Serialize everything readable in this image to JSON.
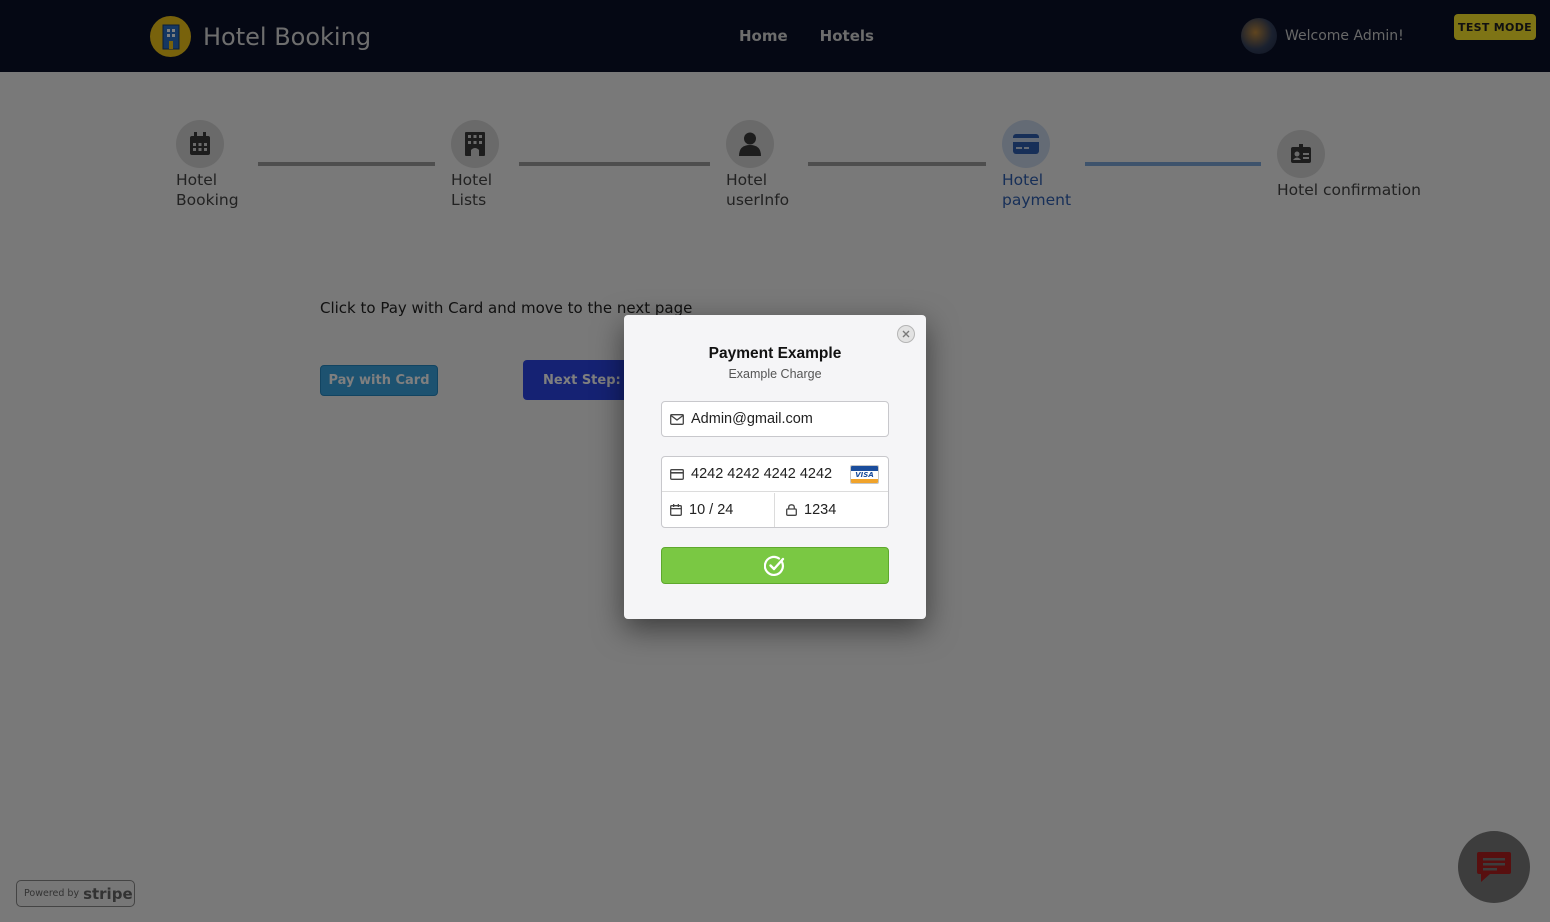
{
  "navbar": {
    "brand_name": "Hotel Booking",
    "links": [
      "Home",
      "Hotels"
    ],
    "welcome_text": "Welcome Admin!",
    "test_mode_label": "TEST MODE"
  },
  "steps": [
    {
      "label_line1": "Hotel",
      "label_line2": "Booking",
      "icon": "calendar-icon",
      "active": false
    },
    {
      "label_line1": "Hotel",
      "label_line2": "Lists",
      "icon": "building-icon",
      "active": false
    },
    {
      "label_line1": "Hotel",
      "label_line2": "userInfo",
      "icon": "user-icon",
      "active": false
    },
    {
      "label_line1": "Hotel",
      "label_line2": "payment",
      "icon": "credit-card-icon",
      "active": true
    },
    {
      "label_line1": "Hotel confirmation",
      "label_line2": "",
      "icon": "id-badge-icon",
      "active": false
    }
  ],
  "main": {
    "instruction": "Click to Pay with Card and move to the next page",
    "pay_button": "Pay with Card",
    "next_button": "Next Step: Co"
  },
  "modal": {
    "title": "Payment Example",
    "subtitle": "Example Charge",
    "email": "Admin@gmail.com",
    "card_number": "4242 4242 4242 4242",
    "card_brand": "VISA",
    "expiry": "10 / 24",
    "cvc": "1234"
  },
  "stripe_badge": {
    "prefix": "Powered by",
    "brand": "stripe"
  },
  "colors": {
    "navbar_bg": "#0a1128",
    "active_step": "#2f5fb0",
    "submit_green": "#7ac843",
    "test_mode_yellow": "#fde92b"
  }
}
